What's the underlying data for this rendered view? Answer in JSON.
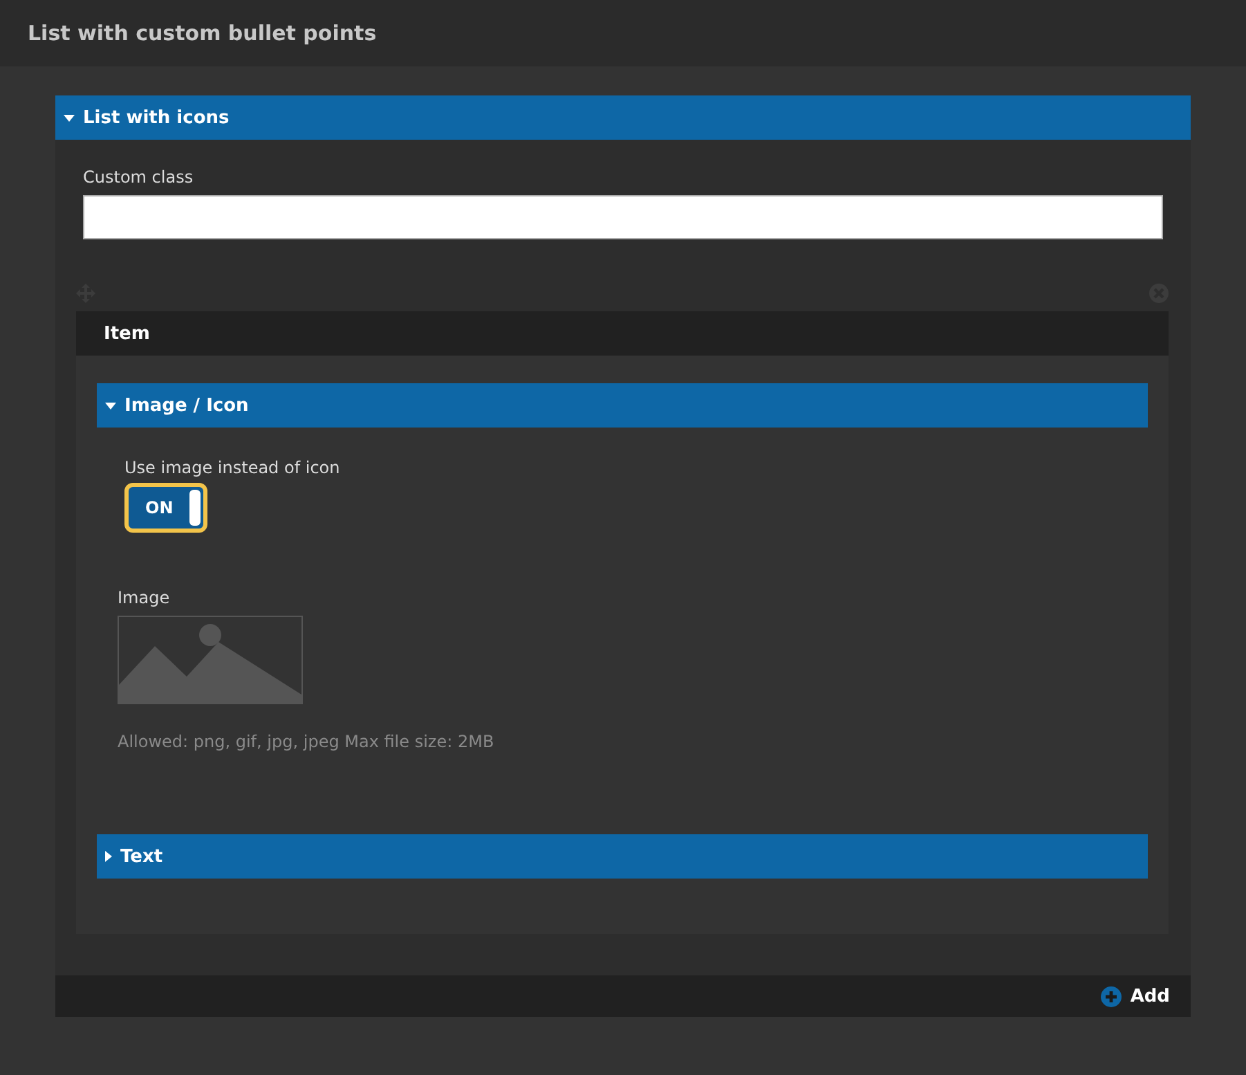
{
  "header": {
    "title": "List with custom bullet points"
  },
  "group": {
    "title": "List with icons",
    "expanded": true,
    "fields": [
      {
        "kind": "text",
        "label": "Custom class"
      }
    ],
    "item": {
      "title": "Item",
      "sections": [
        {
          "title": "Image / Icon",
          "expanded": true,
          "fields": [
            {
              "kind": "toggle",
              "label": "Use image instead of icon",
              "on": true,
              "state_text": "ON"
            },
            {
              "kind": "image",
              "label": "Image",
              "hint": "Allowed: png, gif, jpg, jpeg Max file size: 2MB"
            }
          ]
        },
        {
          "title": "Text",
          "expanded": false
        }
      ]
    },
    "add_button": "Add"
  }
}
